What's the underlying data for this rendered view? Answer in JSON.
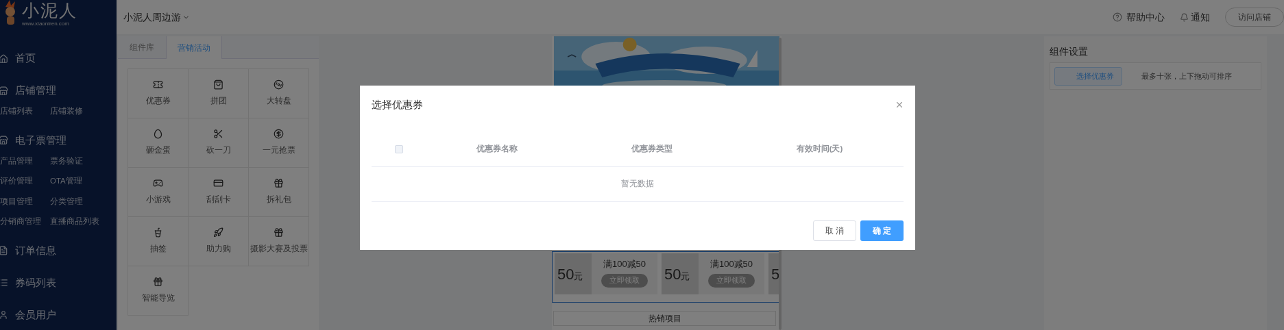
{
  "logo": {
    "name": "小泥人",
    "url": "www.xiaoniren.com"
  },
  "sidebar": {
    "items": [
      {
        "label": "首页"
      },
      {
        "label": "店铺管理",
        "children": [
          {
            "label": "店铺列表"
          },
          {
            "label": "店铺装修"
          }
        ]
      },
      {
        "label": "电子票管理",
        "children": [
          {
            "label": "产品管理"
          },
          {
            "label": "票务验证"
          },
          {
            "label": "评价管理"
          },
          {
            "label": "OTA管理"
          },
          {
            "label": "项目管理"
          },
          {
            "label": "分类管理"
          },
          {
            "label": "分销商管理"
          },
          {
            "label": "直播商品列表"
          }
        ]
      },
      {
        "label": "订单信息"
      },
      {
        "label": "券码列表"
      },
      {
        "label": "会员用户"
      }
    ]
  },
  "header": {
    "shop": "小泥人周边游",
    "help": "帮助中心",
    "notice": "通知",
    "visit": "访问店铺"
  },
  "component_panel": {
    "tabs": [
      {
        "label": "组件库",
        "selected": false
      },
      {
        "label": "营销活动",
        "selected": true
      }
    ],
    "items": [
      {
        "label": "优惠券"
      },
      {
        "label": "拼团"
      },
      {
        "label": "大转盘"
      },
      {
        "label": "砸金蛋"
      },
      {
        "label": "砍一刀"
      },
      {
        "label": "一元抢票"
      },
      {
        "label": "小游戏"
      },
      {
        "label": "刮刮卡"
      },
      {
        "label": "拆礼包"
      },
      {
        "label": "抽签"
      },
      {
        "label": "助力购"
      },
      {
        "label": "摄影大赛及投票"
      },
      {
        "label": "智能导览"
      }
    ]
  },
  "phone": {
    "coupons": [
      {
        "amount": "50",
        "unit": "元",
        "title": "满100减50",
        "action": "立即领取"
      },
      {
        "amount": "50",
        "unit": "元",
        "title": "满100减50",
        "action": "立即领取"
      },
      {
        "amount": "5"
      }
    ],
    "section": "热销项目"
  },
  "settings": {
    "title": "组件设置",
    "button": "选择优惠券",
    "hint": "最多十张，上下拖动可排序"
  },
  "modal": {
    "title": "选择优惠券",
    "select_all": {
      "checked": false
    },
    "columns": [
      "优惠券名称",
      "优惠券类型",
      "有效时间(天)"
    ],
    "empty": "暂无数据",
    "buttons": [
      {
        "label": "取 消",
        "kind": "secondary"
      },
      {
        "label": "确 定",
        "kind": "primary"
      }
    ]
  }
}
